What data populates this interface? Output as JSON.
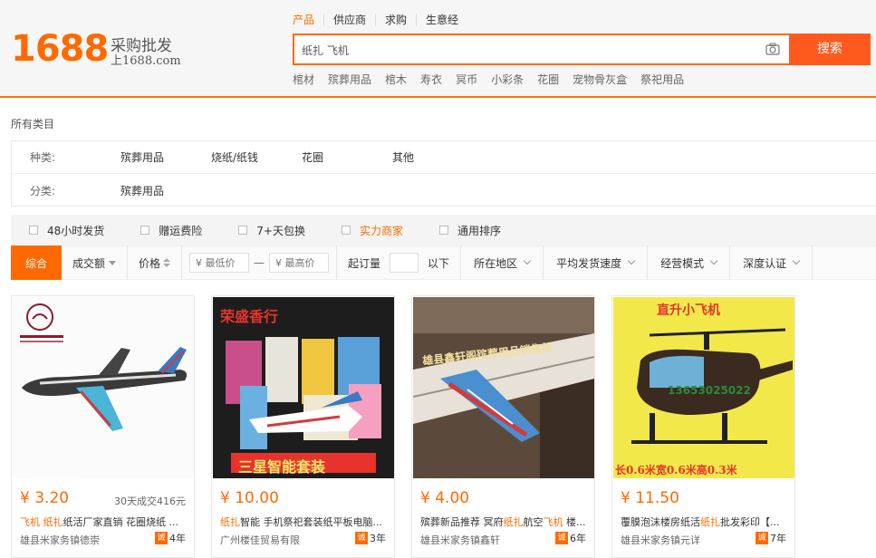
{
  "header": {
    "logo_number": "1688",
    "logo_text": "采购批发",
    "logo_site": "上1688.com",
    "tabs": [
      {
        "label": "产品",
        "active": true
      },
      {
        "label": "供应商",
        "active": false
      },
      {
        "label": "求购",
        "active": false
      },
      {
        "label": "生意经",
        "active": false
      }
    ],
    "search_value": "纸扎 飞机",
    "search_button": "搜索",
    "hot_words": [
      "棺材",
      "殡葬用品",
      "棺木",
      "寿衣",
      "冥币",
      "小彩条",
      "花圈",
      "宠物骨灰盒",
      "祭祀用品"
    ]
  },
  "breadcrumb": "所有类目",
  "filters": {
    "row1": {
      "label": "种类:",
      "values": [
        "殡葬用品",
        "烧纸/纸钱",
        "花圈",
        "其他"
      ]
    },
    "row2": {
      "label": "分类:",
      "values": [
        "殡葬用品"
      ]
    }
  },
  "options": [
    {
      "label": "48小时发货",
      "highlight": false
    },
    {
      "label": "赠运费险",
      "highlight": false
    },
    {
      "label": "7+天包换",
      "highlight": false
    },
    {
      "label": "实力商家",
      "highlight": true
    },
    {
      "label": "通用排序",
      "highlight": false
    }
  ],
  "sort": {
    "active": "综合",
    "volume": "成交额",
    "price": "价格",
    "min_price_placeholder": "¥ 最低价",
    "max_price_placeholder": "¥ 最高价",
    "dash": "—",
    "moq_label": "起订量",
    "moq_suffix": "以下",
    "region": "所在地区",
    "ship_speed": "平均发货速度",
    "mode": "经营模式",
    "cert": "深度认证"
  },
  "products": [
    {
      "price": "¥ 3.20",
      "sales": "30天成交416元",
      "title_hl1": "飞机",
      "title_mid": " ",
      "title_hl2": "纸扎",
      "title_rest": "纸活厂家直销 花圈烧纸 ...",
      "shop": "雄县米家务镇德崇",
      "years": "4年",
      "badge": "诚"
    },
    {
      "price": "¥ 10.00",
      "sales": "",
      "title_hl1": "纸扎",
      "title_mid": "智能 手机祭祀套装纸平板电脑...",
      "title_hl2": "",
      "title_rest": "",
      "shop": "广州楼佳贸易有限",
      "years": "3年",
      "badge": "诚",
      "img_top": "荣盛香行",
      "img_bottom": "三星智能套装"
    },
    {
      "price": "¥ 4.00",
      "sales": "",
      "title_hl1": "",
      "title_mid": "殡葬新品推荐 冥府",
      "title_hl2": "纸扎",
      "title_rest": "航空",
      "title_hl3": "飞机",
      "title_tail": " 楼...",
      "shop": "雄县米家务镇鑫轩",
      "years": "6年",
      "badge": "诚",
      "img_text": "雄县鑫轩阁殡葬用品销售部"
    },
    {
      "price": "¥ 11.50",
      "sales": "",
      "title_hl1": "",
      "title_mid": "覆膜泡沫楼房纸活",
      "title_hl2": "纸扎",
      "title_rest": "批发彩印【...",
      "shop": "雄县米家务镇元详",
      "years": "7年",
      "badge": "诚",
      "img_top": "直升小飞机",
      "img_bottom": "长0.6米宽0.6米高0.3米",
      "img_phone": "13653025022"
    }
  ]
}
